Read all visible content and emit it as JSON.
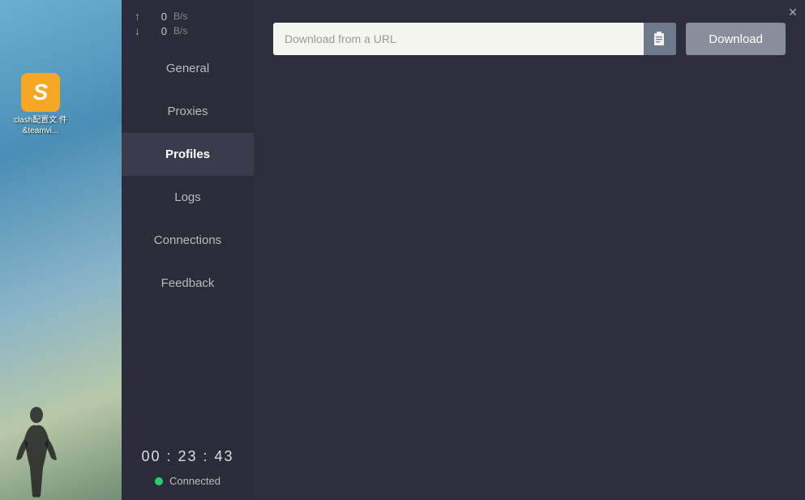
{
  "desktop": {
    "icon": {
      "label": "clash配置文\n件&teamvi...",
      "letter": "S"
    }
  },
  "titlebar": {
    "close_label": "✕"
  },
  "sidebar": {
    "upload_arrow": "↑",
    "download_arrow": "↓",
    "upload_value": "0",
    "download_value": "0",
    "unit": "B/s",
    "nav_items": [
      {
        "id": "general",
        "label": "General",
        "active": false
      },
      {
        "id": "proxies",
        "label": "Proxies",
        "active": false
      },
      {
        "id": "profiles",
        "label": "Profiles",
        "active": true
      },
      {
        "id": "logs",
        "label": "Logs",
        "active": false
      },
      {
        "id": "connections",
        "label": "Connections",
        "active": false
      },
      {
        "id": "feedback",
        "label": "Feedback",
        "active": false
      }
    ],
    "timer": "00 : 23 : 43",
    "connected_label": "Connected"
  },
  "content": {
    "url_placeholder": "Download from a URL",
    "download_button_label": "Download"
  }
}
